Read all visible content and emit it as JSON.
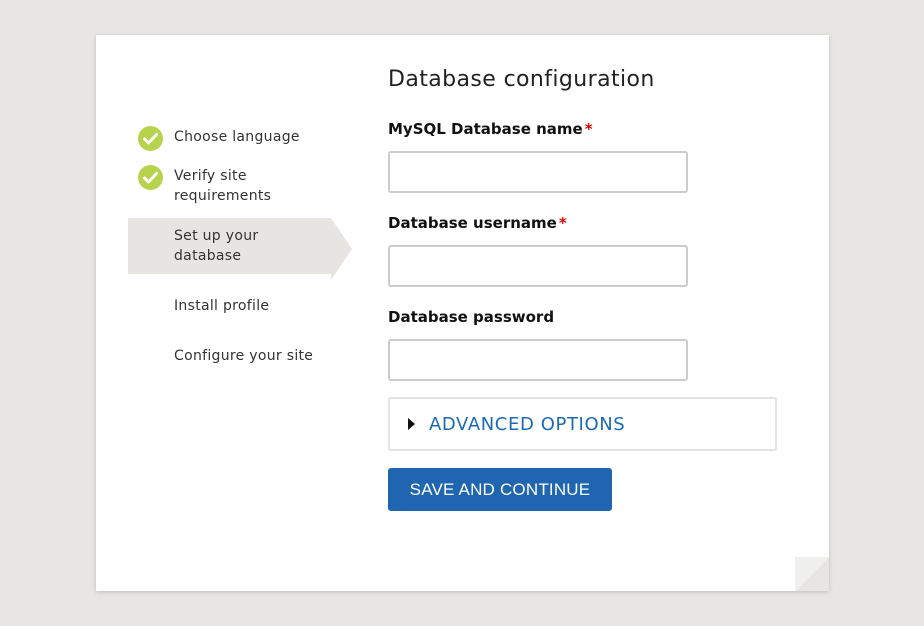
{
  "steps": [
    {
      "label": "Choose language",
      "status": "done"
    },
    {
      "label": "Verify site requirements",
      "status": "done"
    },
    {
      "label": "Set up your database",
      "status": "active"
    },
    {
      "label": "Install profile",
      "status": "pending"
    },
    {
      "label": "Configure your site",
      "status": "pending"
    }
  ],
  "form": {
    "title": "Database configuration",
    "fields": [
      {
        "label": "MySQL Database name",
        "required": true,
        "value": ""
      },
      {
        "label": "Database username",
        "required": true,
        "value": ""
      },
      {
        "label": "Database password",
        "required": false,
        "value": ""
      }
    ],
    "required_marker": "*",
    "advanced_label": "ADVANCED OPTIONS",
    "submit_label": "SAVE AND CONTINUE"
  },
  "colors": {
    "check": "#b7d34d",
    "link": "#1b6ab3",
    "button": "#1f65b0",
    "required": "#e00000",
    "background": "#e7e6e4"
  }
}
